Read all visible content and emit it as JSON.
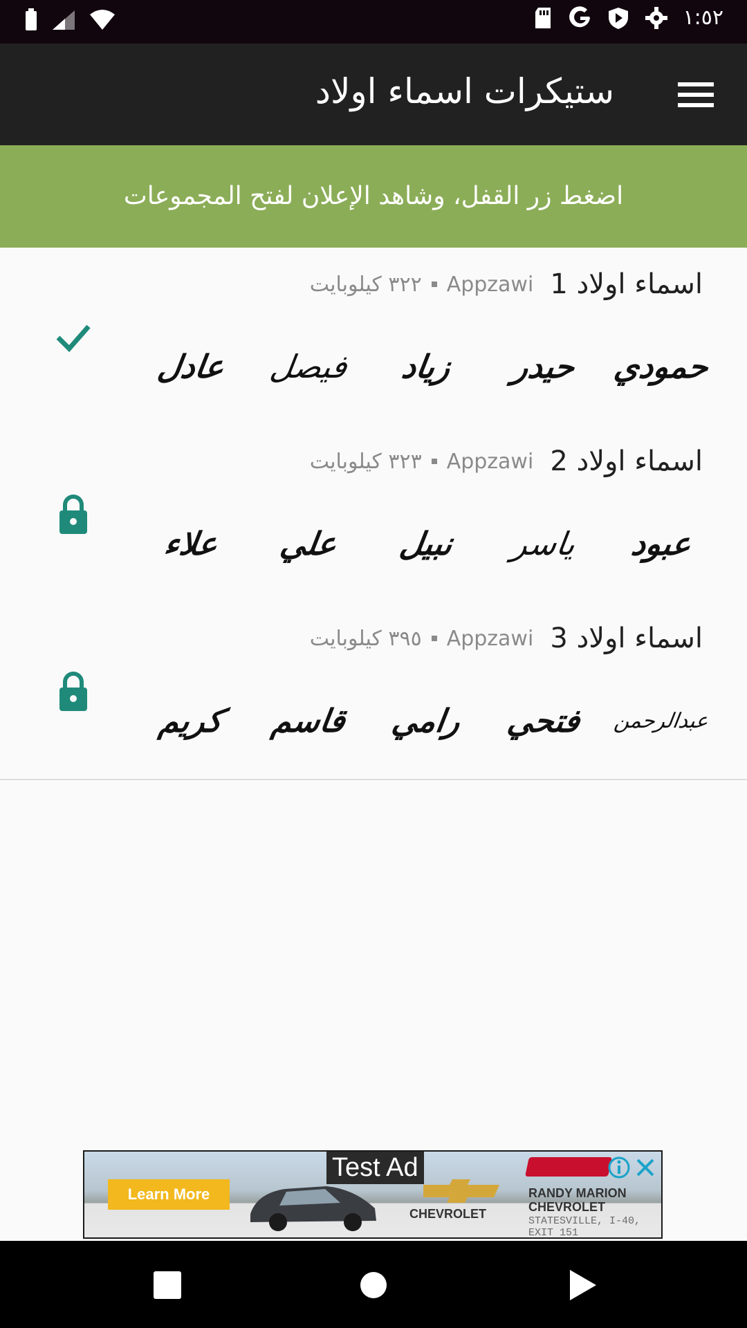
{
  "status_bar": {
    "time": "١:٥٢"
  },
  "toolbar": {
    "title": "ستيكرات اسماء اولاد",
    "menu_icon": "hamburger-menu-icon"
  },
  "banner": {
    "text": "اضغط زر القفل، وشاهد الإعلان لفتح المجموعات"
  },
  "packs": [
    {
      "name": "اسماء اولاد 1",
      "publisher": "Appzawi",
      "size": "٣٢٢ كيلوبايت",
      "status": "added",
      "stickers": [
        "حمودي",
        "حيدر",
        "زياد",
        "فيصل",
        "عادل"
      ]
    },
    {
      "name": "اسماء اولاد 2",
      "publisher": "Appzawi",
      "size": "٣٢٣ كيلوبايت",
      "status": "locked",
      "stickers": [
        "عبود",
        "ياسر",
        "نبيل",
        "علي",
        "علاء"
      ]
    },
    {
      "name": "اسماء اولاد 3",
      "publisher": "Appzawi",
      "size": "٣٩٥ كيلوبايت",
      "status": "locked",
      "stickers": [
        "عبدالرحمن",
        "فتحي",
        "رامي",
        "قاسم",
        "كريم"
      ]
    }
  ],
  "ad": {
    "label": "Test Ad",
    "cta": "Learn More",
    "brand": "CHEVROLET",
    "dealer": "RANDY MARION CHEVROLET",
    "dealer_address": "STATESVILLE, I-40, EXIT 151"
  },
  "colors": {
    "accent": "#1f8a7a",
    "banner": "#8bad57",
    "toolbar": "#212121"
  }
}
